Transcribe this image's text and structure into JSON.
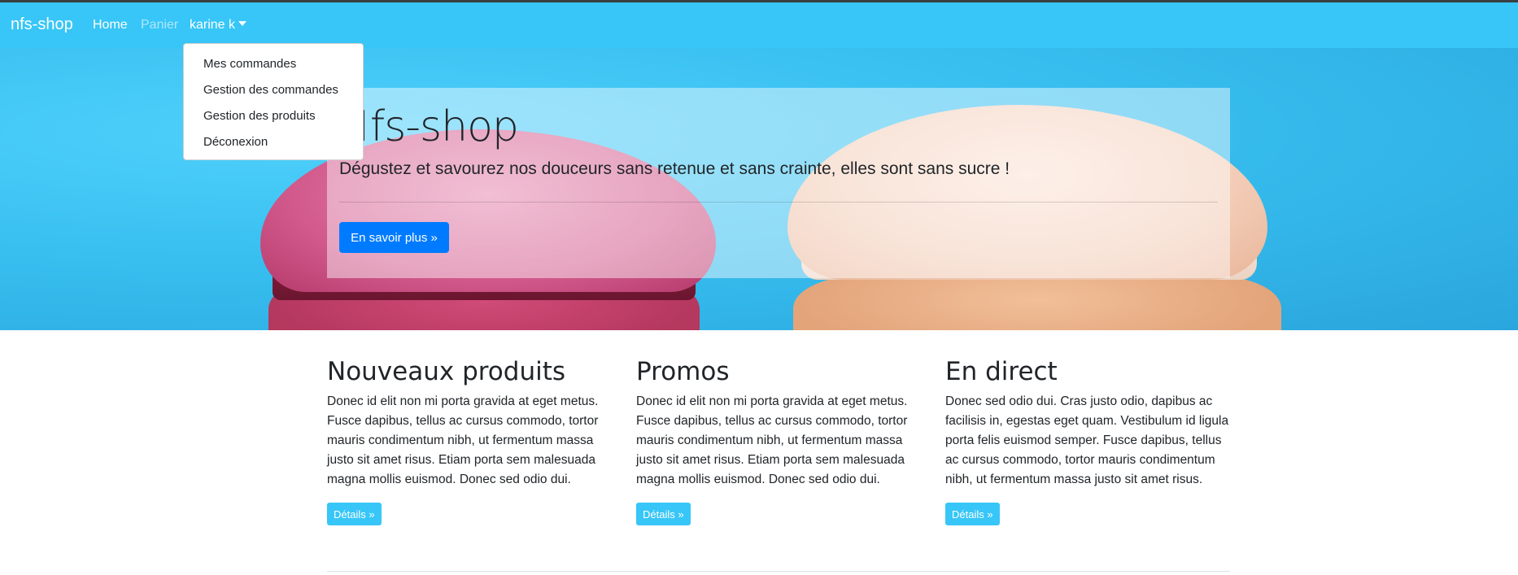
{
  "navbar": {
    "brand": "nfs-shop",
    "links": [
      {
        "label": "Home"
      },
      {
        "label": "Panier"
      }
    ],
    "user_menu_label": "karine k"
  },
  "dropdown": {
    "items": [
      {
        "label": "Mes commandes"
      },
      {
        "label": "Gestion des commandes"
      },
      {
        "label": "Gestion des produits"
      },
      {
        "label": "Déconexion"
      }
    ]
  },
  "hero": {
    "title": "Nfs-shop",
    "lead": "Dégustez et savourez nos douceurs sans retenue et sans crainte, elles sont sans sucre !",
    "button_label": "En savoir plus »"
  },
  "columns": [
    {
      "heading": "Nouveaux produits",
      "text": "Donec id elit non mi porta gravida at eget metus. Fusce dapibus, tellus ac cursus commodo, tortor mauris condimentum nibh, ut fermentum massa justo sit amet risus. Etiam porta sem malesuada magna mollis euismod. Donec sed odio dui.",
      "button_label": "Détails »"
    },
    {
      "heading": "Promos",
      "text": "Donec id elit non mi porta gravida at eget metus. Fusce dapibus, tellus ac cursus commodo, tortor mauris condimentum nibh, ut fermentum massa justo sit amet risus. Etiam porta sem malesuada magna mollis euismod. Donec sed odio dui.",
      "button_label": "Détails »"
    },
    {
      "heading": "En direct",
      "text": "Donec sed odio dui. Cras justo odio, dapibus ac facilisis in, egestas eget quam. Vestibulum id ligula porta felis euismod semper. Fusce dapibus, tellus ac cursus commodo, tortor mauris condimentum nibh, ut fermentum massa justo sit amet risus.",
      "button_label": "Détails »"
    }
  ],
  "colors": {
    "navbar": "#37c6f7",
    "primary": "#007bff",
    "info": "#37c6f7"
  }
}
